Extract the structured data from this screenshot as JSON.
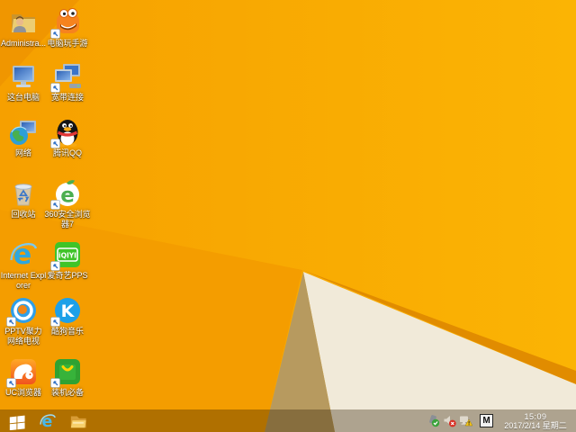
{
  "wallpaper": {
    "base_left": "#f6a000",
    "base_right": "#fbb404",
    "facet_corner": "#ef9300",
    "facet_left": "#f49d00",
    "edge_line": "#e18c00",
    "cream_face": "#f1ead9",
    "tan_face": "#b79a5f"
  },
  "desktop": {
    "icons": [
      {
        "label": "Administra..."
      },
      {
        "label": "电脑玩手游"
      },
      {
        "label": "这台电脑"
      },
      {
        "label": "宽带连接"
      },
      {
        "label": "网络"
      },
      {
        "label": "腾讯QQ"
      },
      {
        "label": "回收站"
      },
      {
        "label": "360安全浏览器7"
      },
      {
        "label": "Internet Explorer"
      },
      {
        "label": "爱奇艺PPS"
      },
      {
        "label": "PPTV聚力 网络电视"
      },
      {
        "label": "酷狗音乐"
      },
      {
        "label": "UC浏览器"
      },
      {
        "label": "装机必备"
      }
    ]
  },
  "icon_glyphs": {
    "ie_letter": "e",
    "browser360_letter": "e",
    "kugou_letter": "K",
    "iqiyi_text": "iQIYI"
  },
  "taskbar": {
    "tray": {
      "time": "15:09",
      "date": "2017/2/14 星期二",
      "ime_label": "M"
    }
  }
}
